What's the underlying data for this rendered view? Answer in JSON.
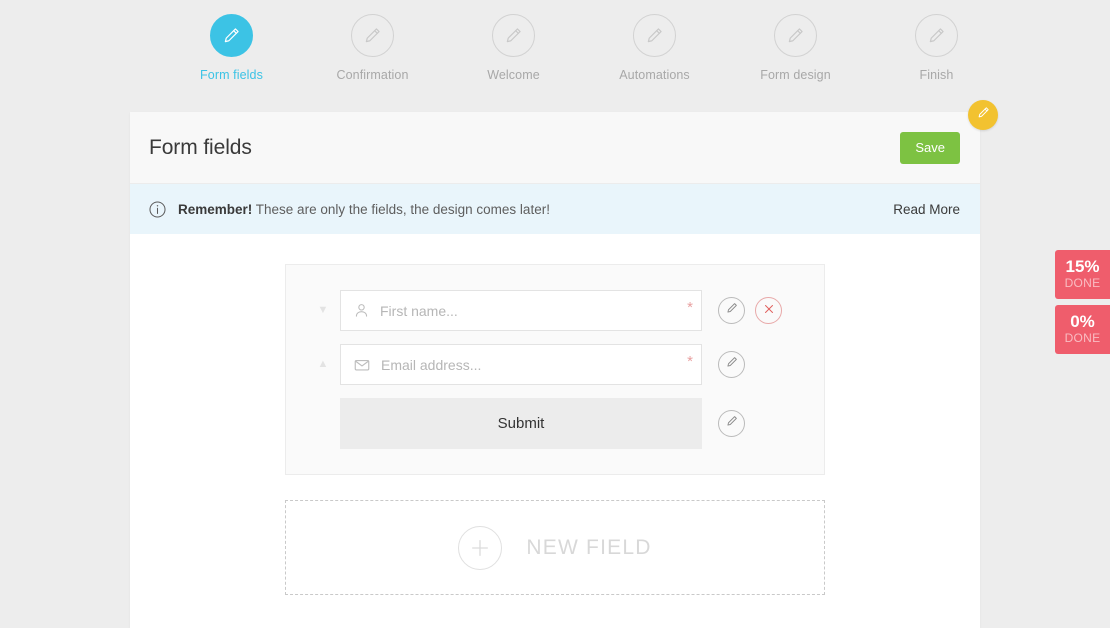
{
  "steps": [
    {
      "label": "Form fields",
      "icon": "pencil-icon",
      "active": true
    },
    {
      "label": "Confirmation",
      "icon": "pencil-icon",
      "active": false
    },
    {
      "label": "Welcome",
      "icon": "pencil-icon",
      "active": false
    },
    {
      "label": "Automations",
      "icon": "pencil-icon",
      "active": false
    },
    {
      "label": "Form design",
      "icon": "pencil-icon",
      "active": false
    },
    {
      "label": "Finish",
      "icon": "pencil-icon",
      "active": false
    }
  ],
  "panel": {
    "title": "Form fields",
    "save_label": "Save",
    "edit_fab_icon": "pencil-icon"
  },
  "banner": {
    "icon": "info-icon",
    "strong": "Remember!",
    "text": " These are only the fields, the design comes later!",
    "read_more_label": "Read More"
  },
  "form_fields": [
    {
      "icon": "user-icon",
      "placeholder": "First name...",
      "required_marker": "*",
      "reorder_arrow": "▼",
      "actions": [
        "edit-icon",
        "delete-icon"
      ]
    },
    {
      "icon": "envelope-icon",
      "placeholder": "Email address...",
      "required_marker": "*",
      "reorder_arrow": "▲",
      "actions": [
        "edit-icon"
      ]
    }
  ],
  "submit": {
    "label": "Submit",
    "action_icon": "edit-icon"
  },
  "new_field": {
    "label": "NEW FIELD",
    "icon": "plus-circle-icon"
  },
  "progress_badges": [
    {
      "percent": "15%",
      "label": "DONE"
    },
    {
      "percent": "0%",
      "label": "DONE"
    }
  ],
  "colors": {
    "accent": "#3cc3e5",
    "save_green": "#7dc242",
    "badge_red": "#ef5d6c",
    "fab_yellow": "#f2c230",
    "banner_blue": "#e9f5fb",
    "page_bg": "#ededed"
  }
}
